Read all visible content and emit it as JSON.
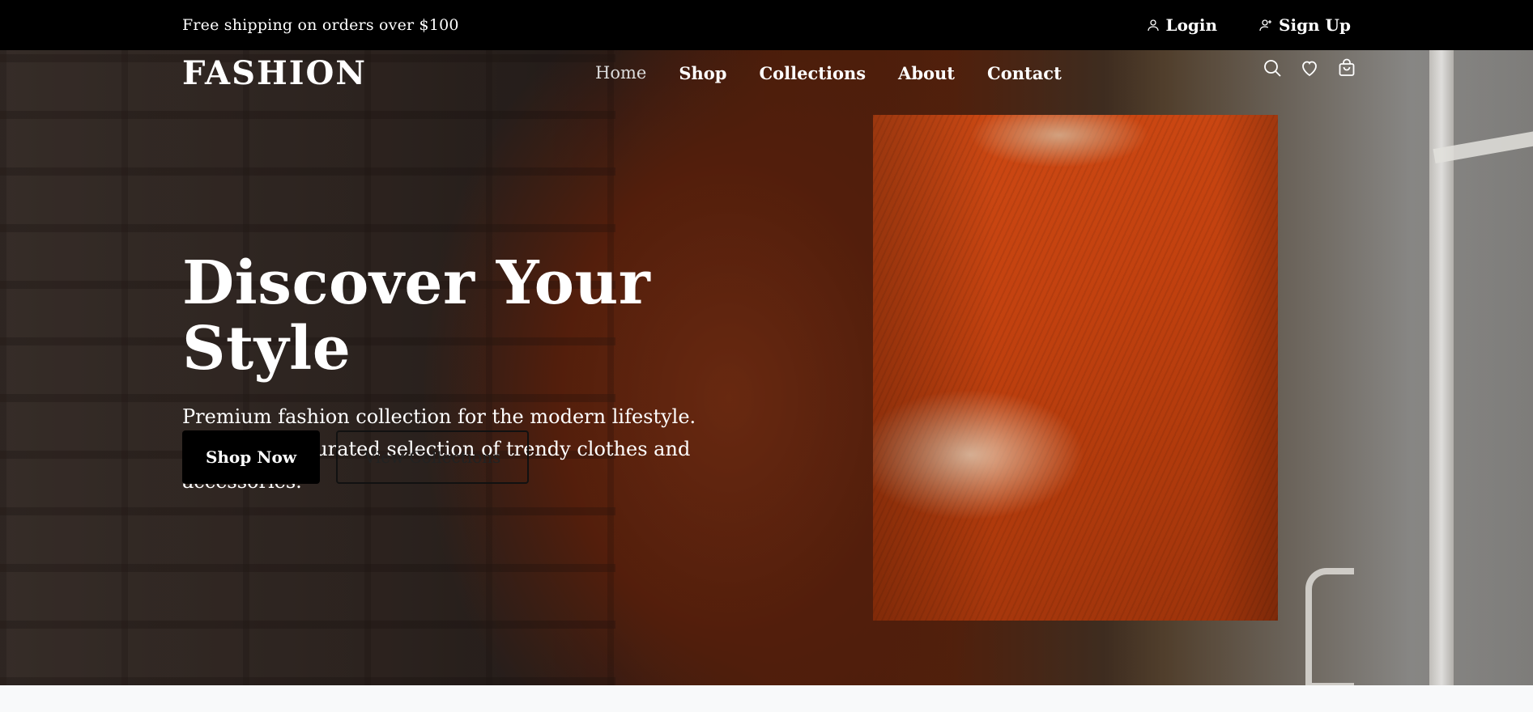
{
  "topbar": {
    "promo": "Free shipping on orders over $100",
    "login": "Login",
    "signup": "Sign Up"
  },
  "nav": {
    "logo": "FASHION",
    "items": [
      "Home",
      "Shop",
      "Collections",
      "About",
      "Contact"
    ],
    "active": "Home",
    "icons": [
      "search-icon",
      "heart-icon",
      "cart-icon"
    ]
  },
  "hero": {
    "title": "Discover Your Style",
    "subtitle": "Premium fashion collection for the modern lifestyle. Explore our curated selection of trendy clothes and accessories.",
    "primary_cta": "Shop Now",
    "secondary_cta": "View Collections"
  },
  "colors": {
    "topbar_bg": "#000000",
    "accent": "#c2410f",
    "below_bg": "#f8f9fa"
  }
}
